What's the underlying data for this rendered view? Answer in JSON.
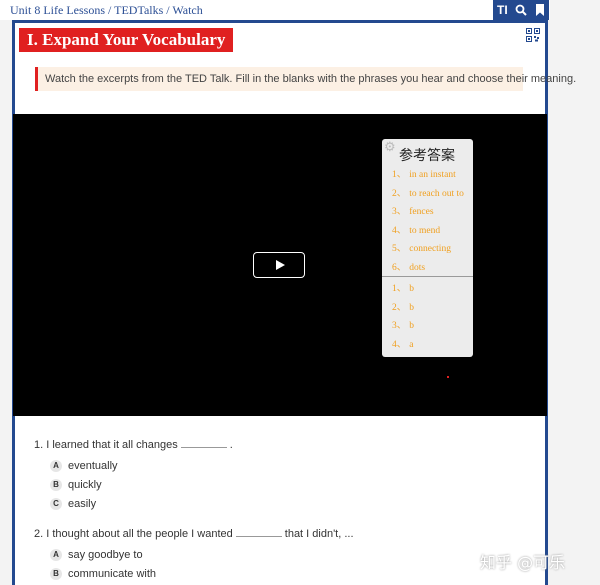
{
  "breadcrumb": {
    "unit": "Unit 8 Life Lessons",
    "section": "TEDTalks",
    "page": "Watch",
    "sep": " / "
  },
  "toolbar": {
    "text_tool": "TI"
  },
  "section": {
    "title": "I. Expand Your Vocabulary"
  },
  "instruction": {
    "text": "Watch the excerpts from the TED Talk. Fill in the blanks with the phrases you hear and choose their meaning."
  },
  "answer_panel": {
    "title": "参考答案",
    "phrases": [
      {
        "num": "1、",
        "text": "in an instant"
      },
      {
        "num": "2、",
        "text": "to reach out to"
      },
      {
        "num": "3、",
        "text": "fences"
      },
      {
        "num": "4、",
        "text": "to mend"
      },
      {
        "num": "5、",
        "text": "connecting"
      },
      {
        "num": "6、",
        "text": "dots"
      }
    ],
    "meanings": [
      {
        "num": "1、",
        "text": "b"
      },
      {
        "num": "2、",
        "text": "b"
      },
      {
        "num": "3、",
        "text": "b"
      },
      {
        "num": "4、",
        "text": "a"
      }
    ]
  },
  "questions": [
    {
      "pre": "1.  I learned that it all changes",
      "post": ".",
      "options": [
        {
          "letter": "A",
          "text": "eventually"
        },
        {
          "letter": "B",
          "text": "quickly"
        },
        {
          "letter": "C",
          "text": "easily"
        }
      ]
    },
    {
      "pre": "2.  I thought about all the people I wanted",
      "post": "that I didn't, ...",
      "options": [
        {
          "letter": "A",
          "text": "say goodbye to"
        },
        {
          "letter": "B",
          "text": "communicate with"
        }
      ]
    }
  ],
  "watermark": {
    "text": "知乎 @可乐"
  }
}
